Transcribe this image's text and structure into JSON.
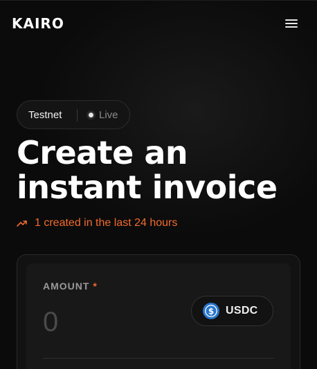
{
  "header": {
    "logo": "KAIRO",
    "menu_icon": "hamburger-menu-icon"
  },
  "network": {
    "name": "Testnet",
    "status": "Live",
    "status_icon": "status-dot-icon"
  },
  "hero": {
    "title": "Create an instant invoice",
    "stat_text": "1 created in the last 24 hours",
    "stat_icon": "trending-up-icon",
    "accent_color": "#f26b2e"
  },
  "form": {
    "amount_label": "AMOUNT",
    "required_marker": "*",
    "amount_placeholder": "0",
    "amount_value": "",
    "token": {
      "symbol": "USDC",
      "icon": "usdc-coin-icon",
      "color": "#2775ca"
    }
  }
}
